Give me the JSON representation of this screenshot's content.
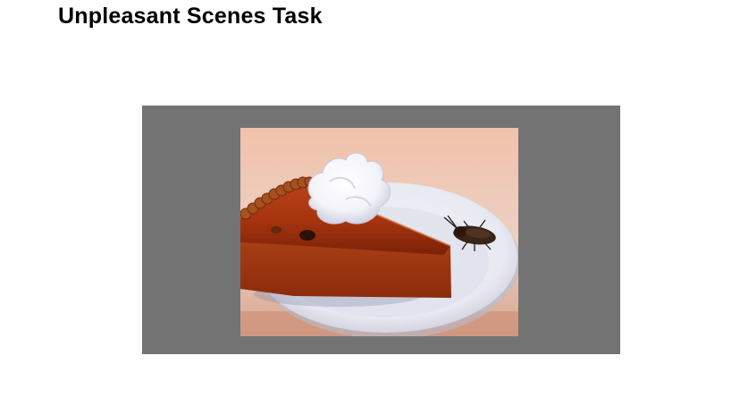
{
  "slide": {
    "title": "Unpleasant Scenes Task"
  },
  "stimulus": {
    "frame_color": "#737373",
    "image_description_icon": "pie-slice-with-cockroach-photo"
  }
}
